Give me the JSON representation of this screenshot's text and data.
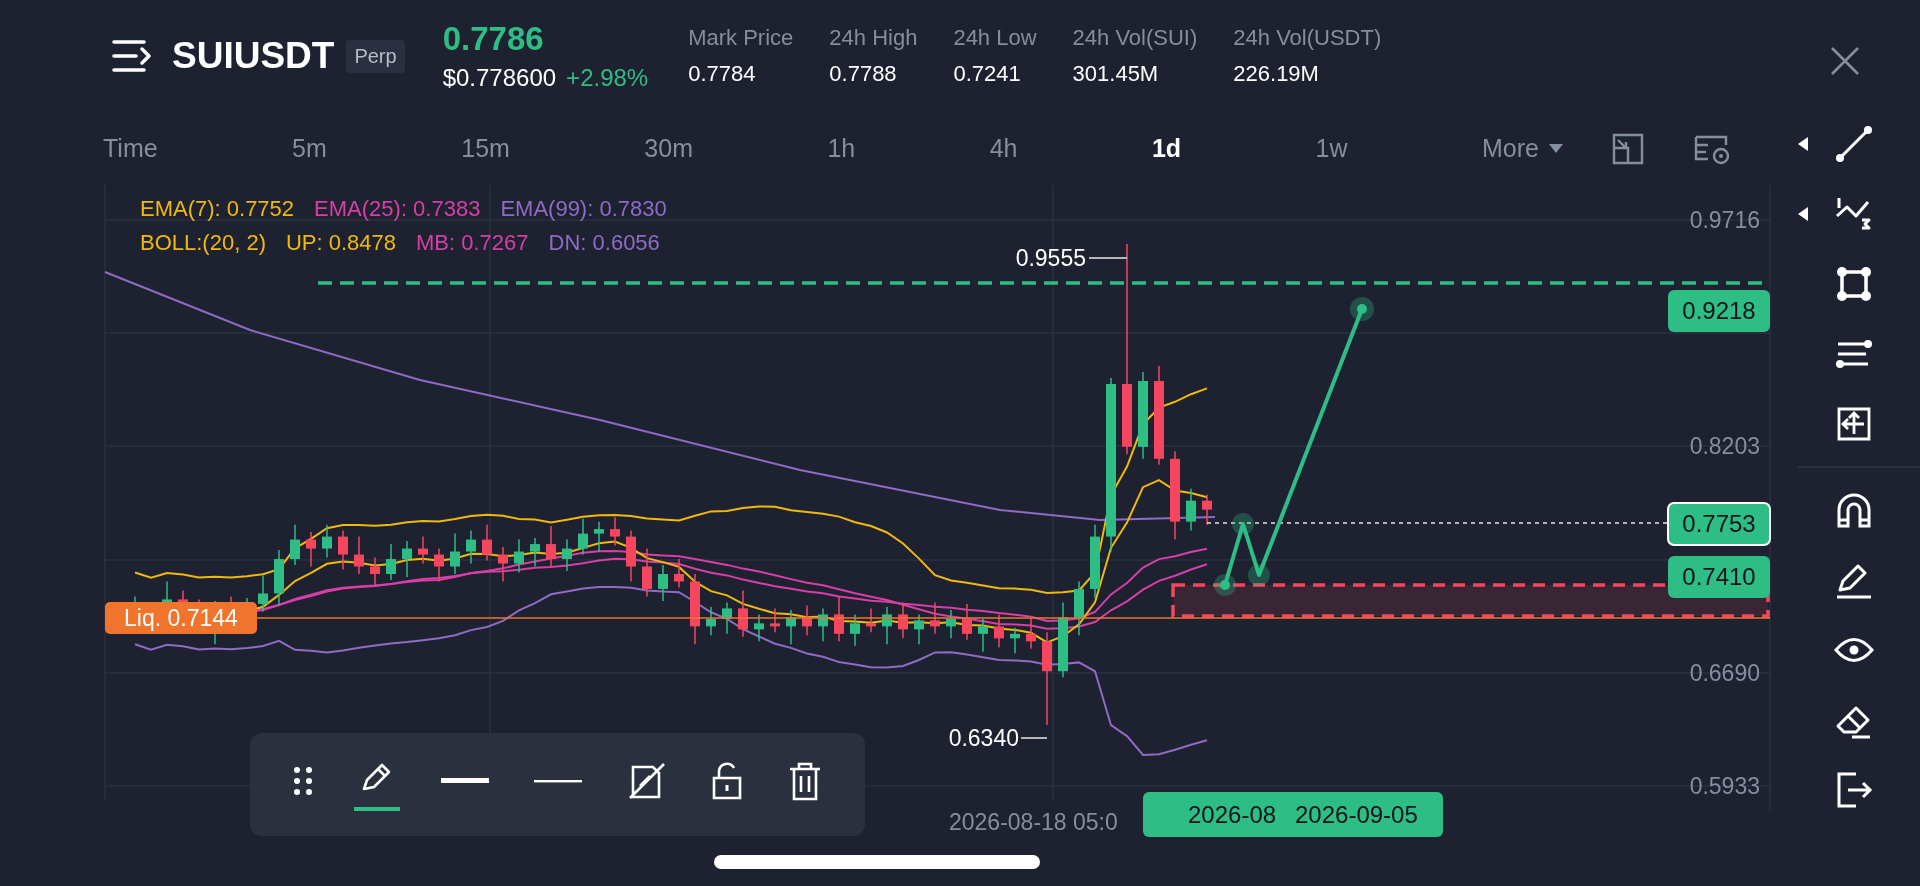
{
  "header": {
    "symbol": "SUIUSDT",
    "contract_badge": "Perp",
    "last_price": "0.7786",
    "usd_price": "$0.778600",
    "change": "+2.98%",
    "stats": [
      {
        "label": "Mark Price",
        "value": "0.7784"
      },
      {
        "label": "24h High",
        "value": "0.7788"
      },
      {
        "label": "24h Low",
        "value": "0.7241"
      },
      {
        "label": "24h Vol(SUI)",
        "value": "301.45M"
      },
      {
        "label": "24h Vol(USDT)",
        "value": "226.19M"
      }
    ]
  },
  "intervals": [
    {
      "label": "Time",
      "kind": "label"
    },
    {
      "label": "5m",
      "kind": "interval",
      "selected": false
    },
    {
      "label": "15m",
      "kind": "interval",
      "selected": false
    },
    {
      "label": "30m",
      "kind": "interval",
      "selected": false
    },
    {
      "label": "1h",
      "kind": "interval",
      "selected": false
    },
    {
      "label": "4h",
      "kind": "interval",
      "selected": false
    },
    {
      "label": "1d",
      "kind": "interval",
      "selected": true
    },
    {
      "label": "1w",
      "kind": "interval",
      "selected": false
    },
    {
      "label": "More",
      "kind": "dropdown",
      "selected": false
    }
  ],
  "chart": {
    "indicators": [
      [
        {
          "text": "EMA(7): 0.7752",
          "color": "#f0b90b"
        },
        {
          "text": "EMA(25): 0.7383",
          "color": "#d63fa6"
        },
        {
          "text": "EMA(99): 0.7830",
          "color": "#8e6bc4"
        }
      ],
      [
        {
          "text": "BOLL:(20, 2)",
          "color": "#f0b90b"
        },
        {
          "text": "UP: 0.8478",
          "color": "#f0b90b"
        },
        {
          "text": "MB: 0.7267",
          "color": "#d63fa6"
        },
        {
          "text": "DN: 0.6056",
          "color": "#8e6bc4"
        }
      ]
    ],
    "price_axis": [
      "0.9716",
      "0.8203",
      "0.6690",
      "0.5933"
    ],
    "price_tags": [
      {
        "text": "0.9218",
        "current": false
      },
      {
        "text": "0.7753",
        "current": true
      },
      {
        "text": "0.7410",
        "current": false
      }
    ],
    "high_label": "0.9555",
    "low_label": "0.6340",
    "liquidation_label": "Liq. 0.7144",
    "time_axis": "2026-08-18 05:0",
    "time_tag": [
      "2026-08",
      "2026-09-05"
    ]
  },
  "drawing_toolbar": [
    {
      "kind": "drag",
      "selected": false
    },
    {
      "kind": "pencil",
      "selected": true
    },
    {
      "kind": "thick-line",
      "selected": false
    },
    {
      "kind": "thin-line",
      "selected": false
    },
    {
      "kind": "hide",
      "selected": false
    },
    {
      "kind": "unlock",
      "selected": false
    },
    {
      "kind": "delete",
      "selected": false
    }
  ],
  "side_toolbar": {
    "drawing_tools": [
      {
        "kind": "trend-line",
        "expandable": true
      },
      {
        "kind": "fib",
        "expandable": true
      },
      {
        "kind": "rectangle",
        "expandable": false
      },
      {
        "kind": "parallel",
        "expandable": false
      },
      {
        "kind": "measure",
        "expandable": false
      }
    ],
    "utility_tools": [
      {
        "kind": "magnet"
      },
      {
        "kind": "pencil"
      },
      {
        "kind": "eye"
      },
      {
        "kind": "eraser"
      },
      {
        "kind": "exit"
      }
    ]
  }
}
